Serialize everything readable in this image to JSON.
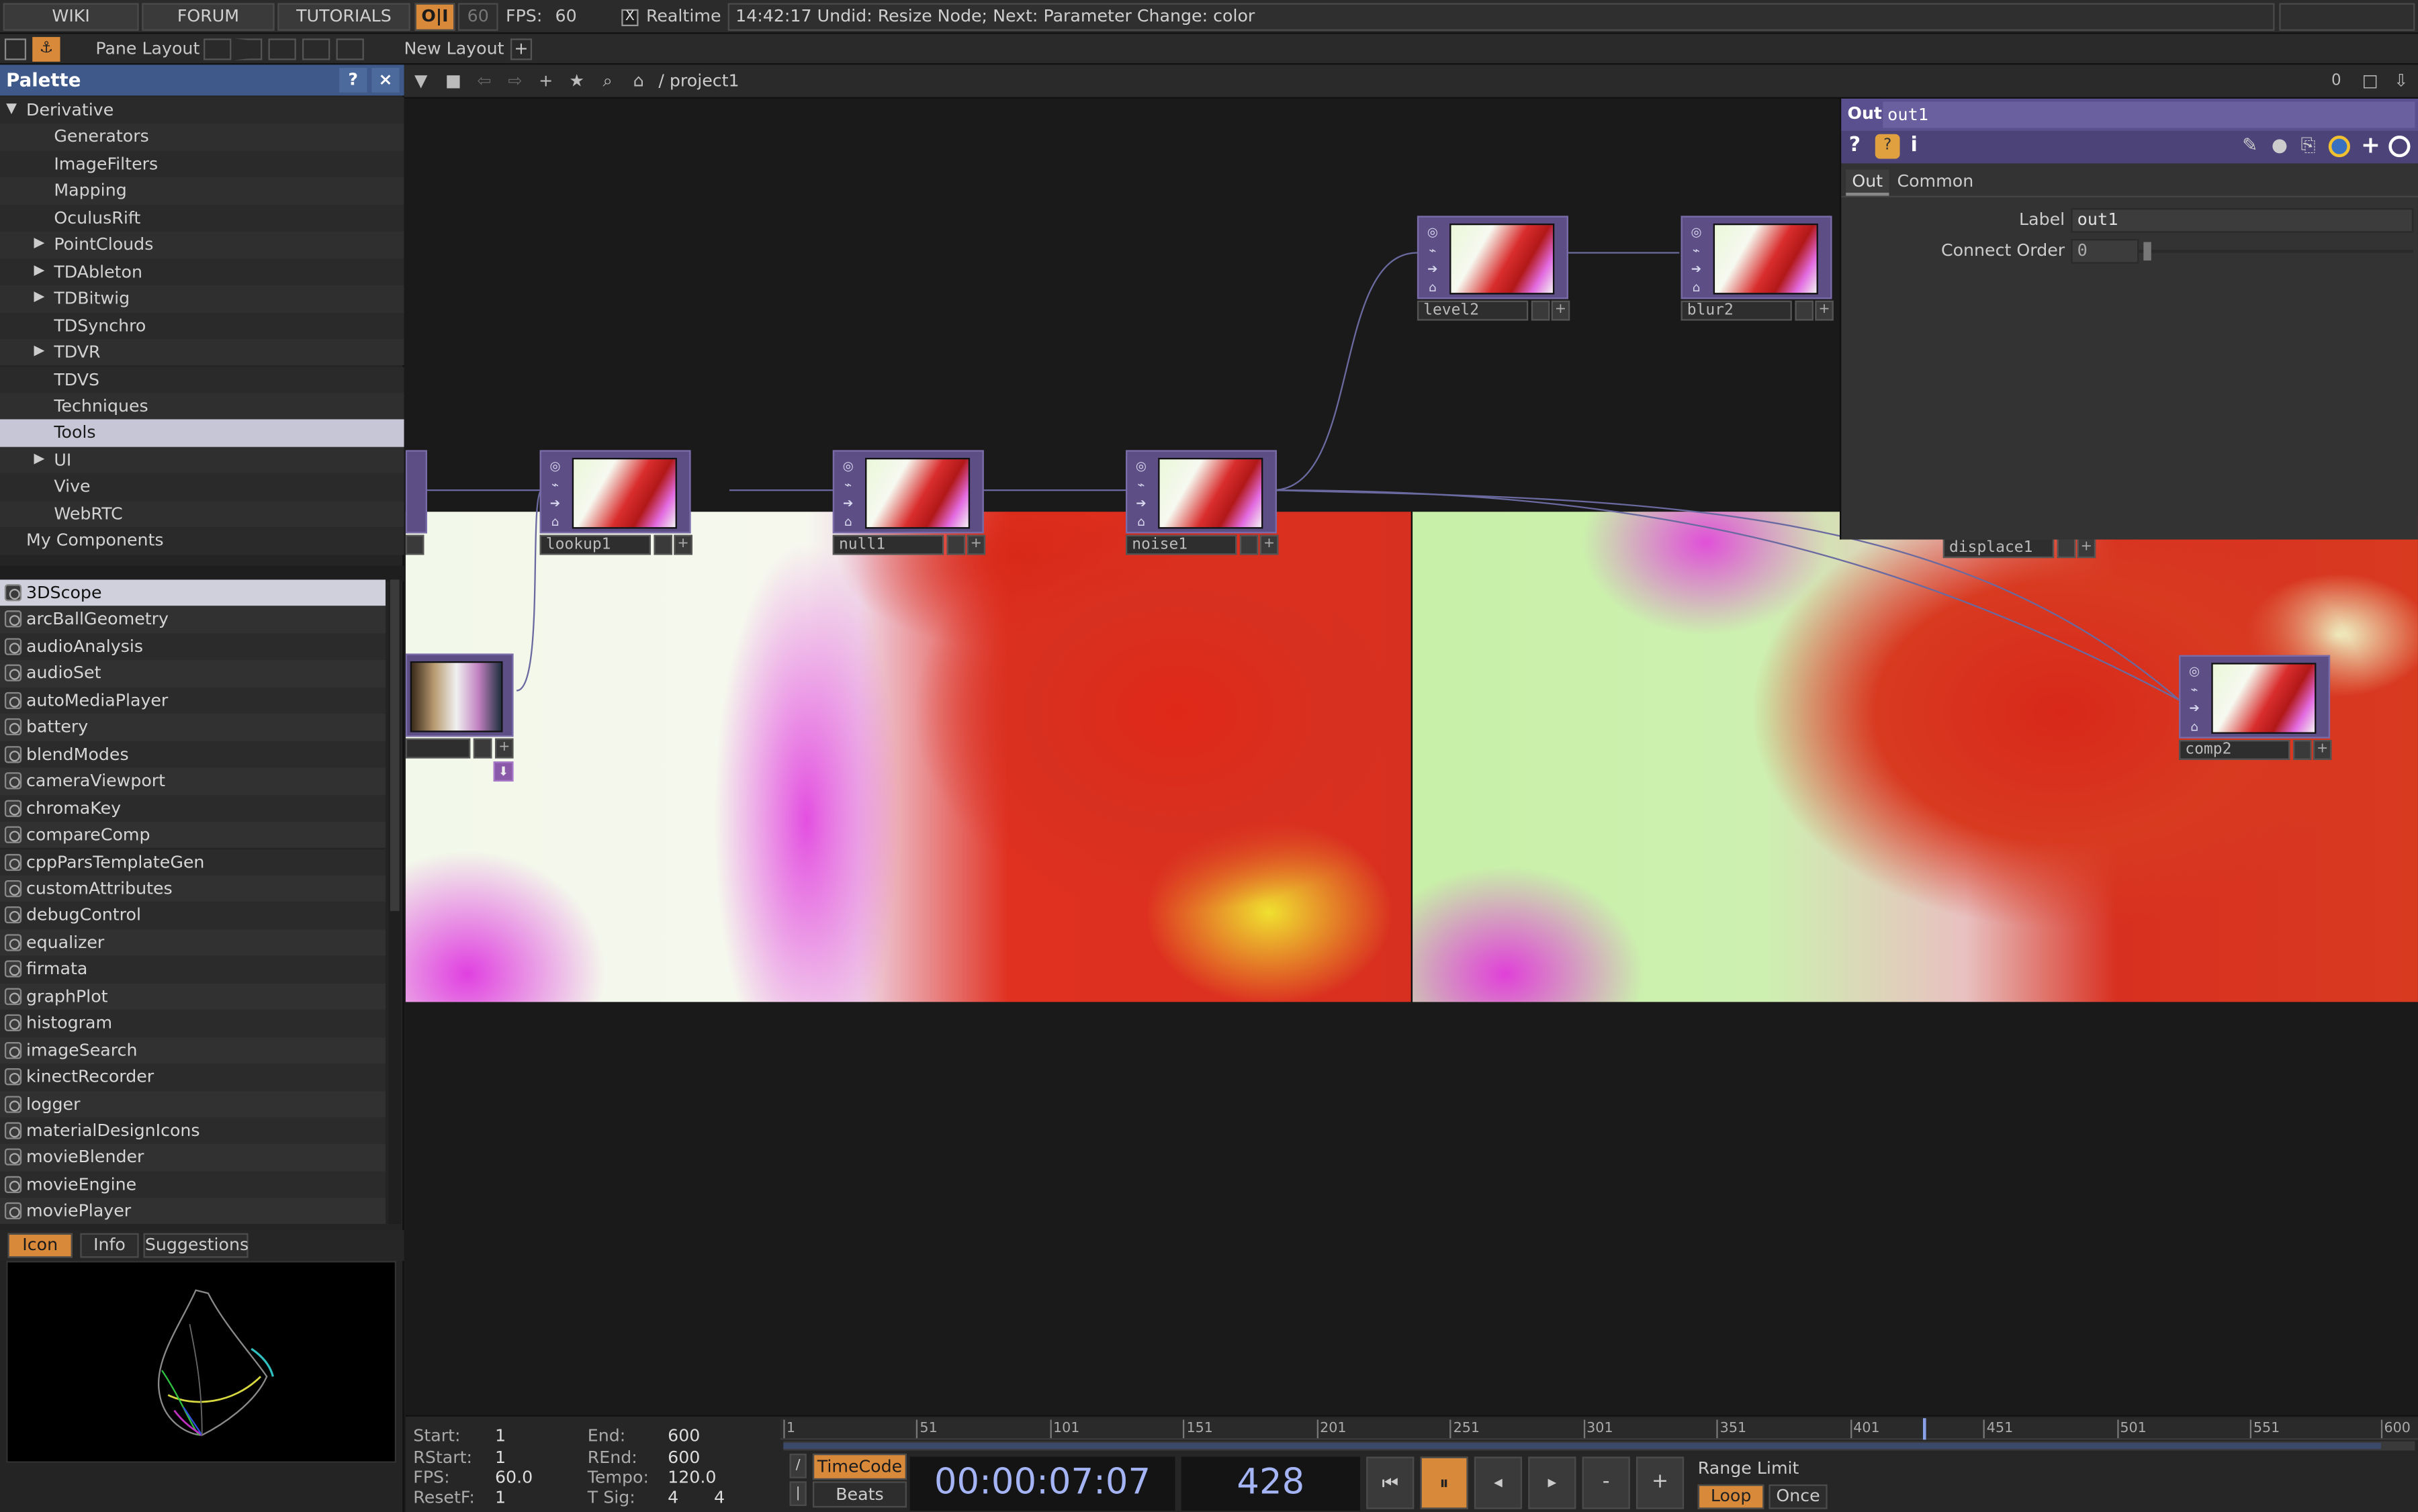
{
  "topbar": {
    "wiki": "WIKI",
    "forum": "FORUM",
    "tutorials": "TUTORIALS",
    "oi": "O|I",
    "fps_cap": "60",
    "fps_label": "FPS:",
    "fps_value": "60",
    "realtime_check": "X",
    "realtime": "Realtime",
    "status": "14:42:17 Undid: Resize Node; Next: Parameter Change: color"
  },
  "layoutbar": {
    "pane_layout": "Pane Layout",
    "new_layout": "New Layout",
    "plus": "+"
  },
  "palette": {
    "title": "Palette",
    "help": "?",
    "close": "×",
    "tree": [
      {
        "label": "Derivative",
        "indent": 1,
        "expanded": true
      },
      {
        "label": "Generators",
        "indent": 2
      },
      {
        "label": "ImageFilters",
        "indent": 2
      },
      {
        "label": "Mapping",
        "indent": 2
      },
      {
        "label": "OculusRift",
        "indent": 2
      },
      {
        "label": "PointClouds",
        "indent": 2,
        "collapsed": true
      },
      {
        "label": "TDAbleton",
        "indent": 2,
        "collapsed": true
      },
      {
        "label": "TDBitwig",
        "indent": 2,
        "collapsed": true
      },
      {
        "label": "TDSynchro",
        "indent": 2
      },
      {
        "label": "TDVR",
        "indent": 2,
        "collapsed": true
      },
      {
        "label": "TDVS",
        "indent": 2
      },
      {
        "label": "Techniques",
        "indent": 2
      },
      {
        "label": "Tools",
        "indent": 2,
        "selected": true
      },
      {
        "label": "UI",
        "indent": 2,
        "collapsed": true
      },
      {
        "label": "Vive",
        "indent": 2
      },
      {
        "label": "WebRTC",
        "indent": 2
      },
      {
        "label": "My Components",
        "indent": 1
      }
    ],
    "components": [
      "3DScope",
      "arcBallGeometry",
      "audioAnalysis",
      "audioSet",
      "autoMediaPlayer",
      "battery",
      "blendModes",
      "cameraViewport",
      "chromaKey",
      "compareComp",
      "cppParsTemplateGen",
      "customAttributes",
      "debugControl",
      "equalizer",
      "firmata",
      "graphPlot",
      "histogram",
      "imageSearch",
      "kinectRecorder",
      "logger",
      "materialDesignIcons",
      "movieBlender",
      "movieEngine",
      "moviePlayer"
    ],
    "selected_component": "3DScope",
    "tabs": [
      "Icon",
      "Info",
      "Suggestions"
    ],
    "active_tab": "Icon"
  },
  "network": {
    "path": "/ project1",
    "zoom_value": "0",
    "nodes": [
      {
        "name": "lookup1"
      },
      {
        "name": "null1"
      },
      {
        "name": "noise1"
      },
      {
        "name": "level2"
      },
      {
        "name": "blur2"
      },
      {
        "name": "displace1"
      },
      {
        "name": "comp2"
      }
    ]
  },
  "params": {
    "op_type": "Out",
    "op_name": "out1",
    "tabs": [
      "Out",
      "Common"
    ],
    "active_tab": "Out",
    "label_name": "Label",
    "label_value": "out1",
    "connect_order_name": "Connect Order",
    "connect_order_value": "0"
  },
  "timeline": {
    "start_label": "Start:",
    "start": "1",
    "end_label": "End:",
    "end": "600",
    "rstart_label": "RStart:",
    "rstart": "1",
    "rend_label": "REnd:",
    "rend": "600",
    "fps_label": "FPS:",
    "fps": "60.0",
    "tempo_label": "Tempo:",
    "tempo": "120.0",
    "resetf_label": "ResetF:",
    "resetf": "1",
    "tsig_label": "T Sig:",
    "tsig_a": "4",
    "tsig_b": "4",
    "ticks": [
      "1",
      "51",
      "101",
      "151",
      "201",
      "251",
      "301",
      "351",
      "401",
      "451",
      "501",
      "551",
      "600"
    ],
    "current_frame_value": 428,
    "timecode_btn": "TimeCode",
    "beats_btn": "Beats",
    "timecode": "00:00:07:07",
    "frame": "428",
    "range_limit": "Range Limit",
    "loop": "Loop",
    "once": "Once",
    "minus": "-",
    "plus": "+"
  },
  "colors": {
    "accent": "#d9893a",
    "palette_header": "#3f5a8a",
    "node_purple": "#5d4f86",
    "selection": "#c6c6d6"
  }
}
